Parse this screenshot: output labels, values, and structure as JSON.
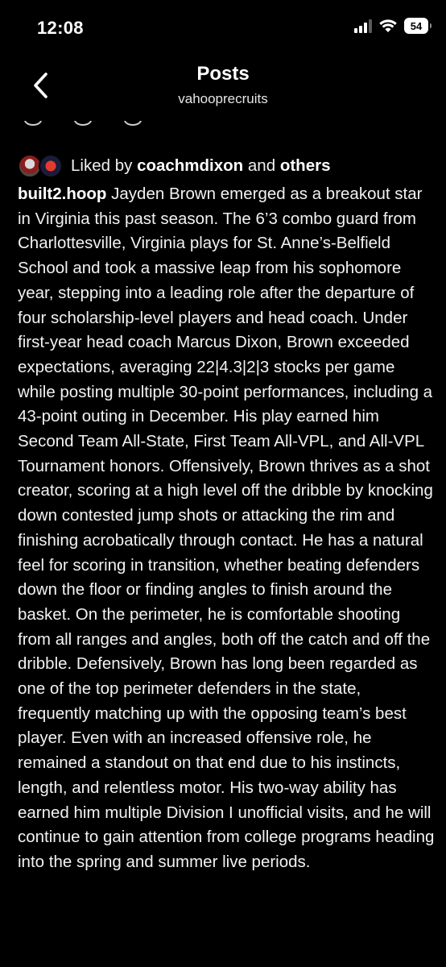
{
  "status_bar": {
    "time": "12:08",
    "battery": "54",
    "icons": [
      "signal-icon",
      "wifi-icon",
      "battery-icon"
    ]
  },
  "header": {
    "title": "Posts",
    "subtitle": "vahooprecruits",
    "back_icon": "chevron-left-icon"
  },
  "likes": {
    "prefix": "Liked by",
    "user": "coachmdixon",
    "joiner": "and",
    "others": "others"
  },
  "post": {
    "author": "built2.hoop",
    "caption": "Jayden Brown emerged as a breakout star in Virginia this past season. The 6’3 combo guard from Charlottesville, Virginia plays for St. Anne’s-Belfield School and took a massive leap from his sophomore year, stepping into a leading role after the departure of four scholarship-level players and head coach. Under first-year head coach Marcus Dixon, Brown exceeded expectations, averaging 22|4.3|2|3 stocks per game while posting multiple 30-point performances, including a 43-point outing in December. His play earned him Second Team All-State, First Team All-VPL, and All-VPL Tournament honors. Offensively, Brown thrives as a shot creator, scoring at a high level off the dribble by knocking down contested jump shots or attacking the rim and finishing acrobatically through contact. He has a natural feel for scoring in transition, whether beating defenders down the floor or finding angles to finish around the basket. On the perimeter, he is comfortable shooting from all ranges and angles, both off the catch and off the dribble. Defensively, Brown has long been regarded as one of the top perimeter defenders in the state, frequently matching up with the opposing team’s best player. Even with an increased offensive role, he remained a standout on that end due to his instincts, length, and relentless motor. His two-way ability has earned him multiple Division I unofficial visits, and he will continue to gain attention from college programs heading into the spring and summer live periods."
  }
}
